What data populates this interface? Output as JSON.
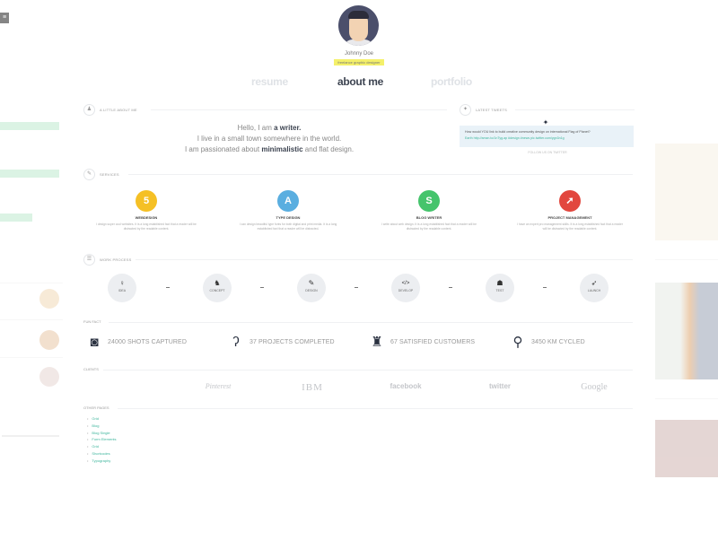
{
  "profile": {
    "name": "Johnny Doe",
    "tagline": "freelance graphic designer"
  },
  "nav": {
    "items": [
      {
        "label": "resume",
        "active": false
      },
      {
        "label": "about me",
        "active": true
      },
      {
        "label": "portfolio",
        "active": false
      }
    ]
  },
  "about": {
    "section_label": "A LITTLE ABOUT ME",
    "line1_prefix": "Hello, I am ",
    "line1_bold": "a writer.",
    "line2": "I live in a small town somewhere in the world.",
    "line3_prefix": "I am passionated about ",
    "line3_bold": "minimalistic",
    "line3_suffix": " and flat design."
  },
  "tweets": {
    "section_label": "LATEST TWEETS",
    "text": "How would YOU link to build creative community design on international Flag of Planet?",
    "link": "Earth http://amzn.to/1nTyg.ap  #design  #news  pic.twitter.com/ygn3n1g",
    "follow": "FOLLOW US ON TWITTER"
  },
  "services": {
    "section_label": "SERVICES",
    "items": [
      {
        "icon": "html5-icon",
        "glyph": "5",
        "color": "#f5c025",
        "title": "WEBDESIGN",
        "desc": "I design super cool websites. It is a long established fact that a reader will be distracted by the readable content."
      },
      {
        "icon": "type-icon",
        "glyph": "A",
        "color": "#5aaee0",
        "title": "TYPE DESIGN",
        "desc": "I can design beautiful type fonts for both digital and print media. It is a long established fact that a reader will be distracted."
      },
      {
        "icon": "blog-icon",
        "glyph": "S",
        "color": "#45c46c",
        "title": "BLOG WRITER",
        "desc": "I write about web design. It is a long established fact that a reader will be distracted by the readable content."
      },
      {
        "icon": "rocket-icon",
        "glyph": "➚",
        "color": "#e2473e",
        "title": "PROJECT MANAGEMENT",
        "desc": "I have an expert pro management skills. It is a long established fact that a reader will be distracted by the readable content."
      }
    ]
  },
  "process": {
    "section_label": "WORK PROCESS",
    "steps": [
      {
        "icon": "lightbulb-icon",
        "glyph": "♀",
        "label": "IDEA"
      },
      {
        "icon": "concept-icon",
        "glyph": "♞",
        "label": "CONCEPT"
      },
      {
        "icon": "brush-icon",
        "glyph": "✎",
        "label": "DESIGN"
      },
      {
        "icon": "code-icon",
        "glyph": "</>",
        "label": "DEVELOP"
      },
      {
        "icon": "bug-icon",
        "glyph": "☗",
        "label": "TEST"
      },
      {
        "icon": "rocket-icon",
        "glyph": "➶",
        "label": "LAUNCH"
      }
    ]
  },
  "funfacts": {
    "section_label": "FUN FACT",
    "items": [
      {
        "icon": "camera-icon",
        "glyph": "◙",
        "text": "24000 SHOTS CAPTURED"
      },
      {
        "icon": "ear-icon",
        "glyph": "ʔ",
        "text": "37 PROJECTS COMPLETED"
      },
      {
        "icon": "customer-icon",
        "glyph": "♜",
        "text": "67 SATISFIED CUSTOMERS"
      },
      {
        "icon": "bicycle-icon",
        "glyph": "⚲",
        "text": "3450 KM CYCLED"
      }
    ]
  },
  "clients": {
    "section_label": "CLIENTS",
    "items": [
      "",
      "Pinterest",
      "IBM",
      "facebook",
      "twitter",
      "Google"
    ]
  },
  "other_pages": {
    "section_label": "OTHER PAGES",
    "items": [
      "Grid",
      "Blog",
      "Blog Single",
      "Form Elements",
      "Grid",
      "Shortcodes",
      "Typography"
    ]
  },
  "colors": {
    "accent": "#3db59c",
    "nav_active": "#3c4350",
    "nav_inactive": "#dfe2e6",
    "tagline_bg": "#f4f06a"
  }
}
